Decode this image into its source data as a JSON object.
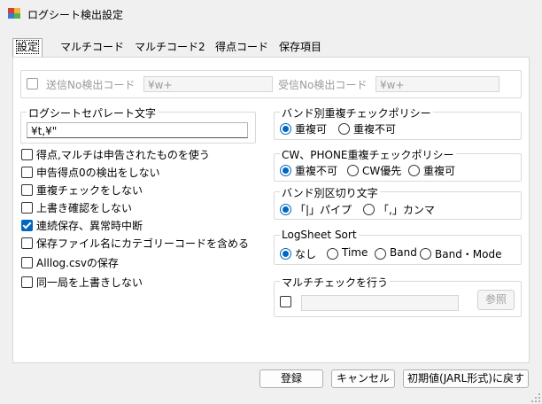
{
  "window": {
    "title": "ログシート検出設定"
  },
  "tabs": [
    "設定",
    "マルチコード",
    "マルチコード2",
    "得点コード",
    "保存項目"
  ],
  "detect": {
    "send_label": "送信No検出コード",
    "send_value": "¥w+",
    "recv_label": "受信No検出コード",
    "recv_value": "¥w+"
  },
  "separator": {
    "group_label": "ログシートセパレート文字",
    "value": "¥t,¥\""
  },
  "options": [
    {
      "label": "得点,マルチは申告されたものを使う",
      "checked": false
    },
    {
      "label": "申告得点0の検出をしない",
      "checked": false
    },
    {
      "label": "重複チェックをしない",
      "checked": false
    },
    {
      "label": "上書き確認をしない",
      "checked": false
    },
    {
      "label": "連続保存、異常時中断",
      "checked": true
    },
    {
      "label": "保存ファイル名にカテゴリーコードを含める",
      "checked": false
    },
    {
      "label": "Alllog.csvの保存",
      "checked": false
    },
    {
      "label": "同一局を上書きしない",
      "checked": false
    }
  ],
  "band_dup": {
    "group_label": "バンド別重複チェックポリシー",
    "options": [
      "重複可",
      "重複不可"
    ],
    "selected": 0
  },
  "cw_phone": {
    "group_label": "CW、PHONE重複チェックポリシー",
    "options": [
      "重複不可",
      "CW優先",
      "重複可"
    ],
    "selected": 0
  },
  "band_sep": {
    "group_label": "バンド別区切り文字",
    "options": [
      "「|」パイプ",
      "「,」カンマ"
    ],
    "selected": 0
  },
  "sort": {
    "group_label": "LogSheet Sort",
    "options": [
      "なし",
      "Time",
      "Band",
      "Band・Mode"
    ],
    "selected": 0
  },
  "multi_check": {
    "group_label": "マルチチェックを行う",
    "browse_label": "参照",
    "path_value": ""
  },
  "buttons": {
    "register": "登録",
    "cancel": "キャンセル",
    "reset": "初期値(JARL形式)に戻す"
  }
}
